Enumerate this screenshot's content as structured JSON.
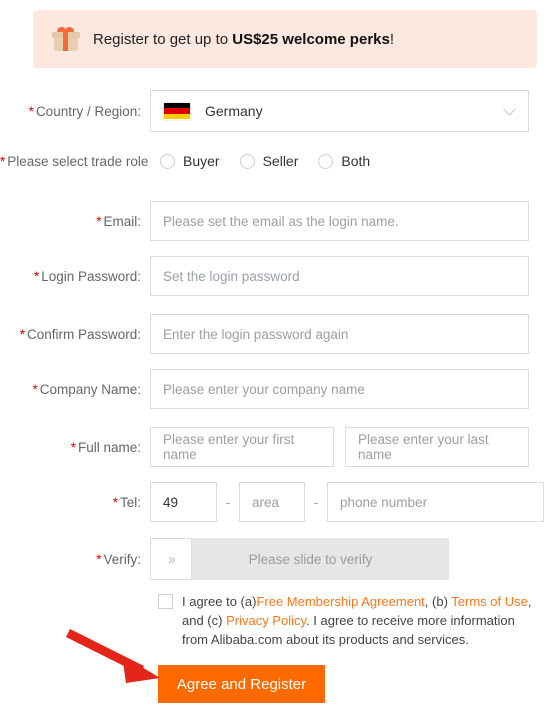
{
  "promo": {
    "icon": "gift-box-icon",
    "text_before": "Register to get up to ",
    "highlight": "US$25 welcome perks",
    "text_after": "!",
    "background_color": "#FDE8DF"
  },
  "form": {
    "country": {
      "label": "Country / Region:",
      "required_marker": "*",
      "selected": "Germany",
      "flag": "germany-flag-icon",
      "chevron": "chevron-down-icon"
    },
    "trade_role": {
      "label": "Please select trade role",
      "required_marker": "*",
      "options": [
        {
          "label": "Buyer",
          "selected": false
        },
        {
          "label": "Seller",
          "selected": false
        },
        {
          "label": "Both",
          "selected": false
        }
      ]
    },
    "fields": [
      {
        "label": "Email:",
        "required_marker": "*",
        "placeholder": "Please set the email as the login name.",
        "value": ""
      },
      {
        "label": "Login Password:",
        "required_marker": "*",
        "placeholder": "Set the login password",
        "value": ""
      },
      {
        "label": "Confirm Password:",
        "required_marker": "*",
        "placeholder": "Enter the login password again",
        "value": ""
      },
      {
        "label": "Company Name:",
        "required_marker": "*",
        "placeholder": "Please enter your company name",
        "value": ""
      }
    ],
    "full_name": {
      "label": "Full name:",
      "required_marker": "*",
      "first_placeholder": "Please enter your first name",
      "last_placeholder": "Please enter your last name",
      "first_value": "",
      "last_value": ""
    },
    "tel": {
      "label": "Tel:",
      "required_marker": "*",
      "country_code_value": "49",
      "area_placeholder": "area",
      "area_value": "",
      "number_placeholder": "phone number",
      "number_value": "",
      "separator": "-"
    },
    "verify": {
      "label": "Verify:",
      "required_marker": "*",
      "handle_icon": "double-chevron-right-icon",
      "handle_glyph": "››",
      "track_text": "Please slide to verify"
    }
  },
  "agreement": {
    "checked": false,
    "part1": "I agree to (a)",
    "link1": "Free Membership Agreement",
    "part2": ", (b) ",
    "link2": "Terms of Use",
    "part3": ", and (c) ",
    "link3": "Privacy Policy",
    "part4": ". I agree to receive more information from Alibaba.com about its products and services.",
    "link_color": "#FF7519"
  },
  "submit": {
    "label": "Agree and Register",
    "background_color": "#FF6A00"
  },
  "annotation": {
    "arrow": "red-pointer-arrow",
    "color": "#E3251B"
  }
}
